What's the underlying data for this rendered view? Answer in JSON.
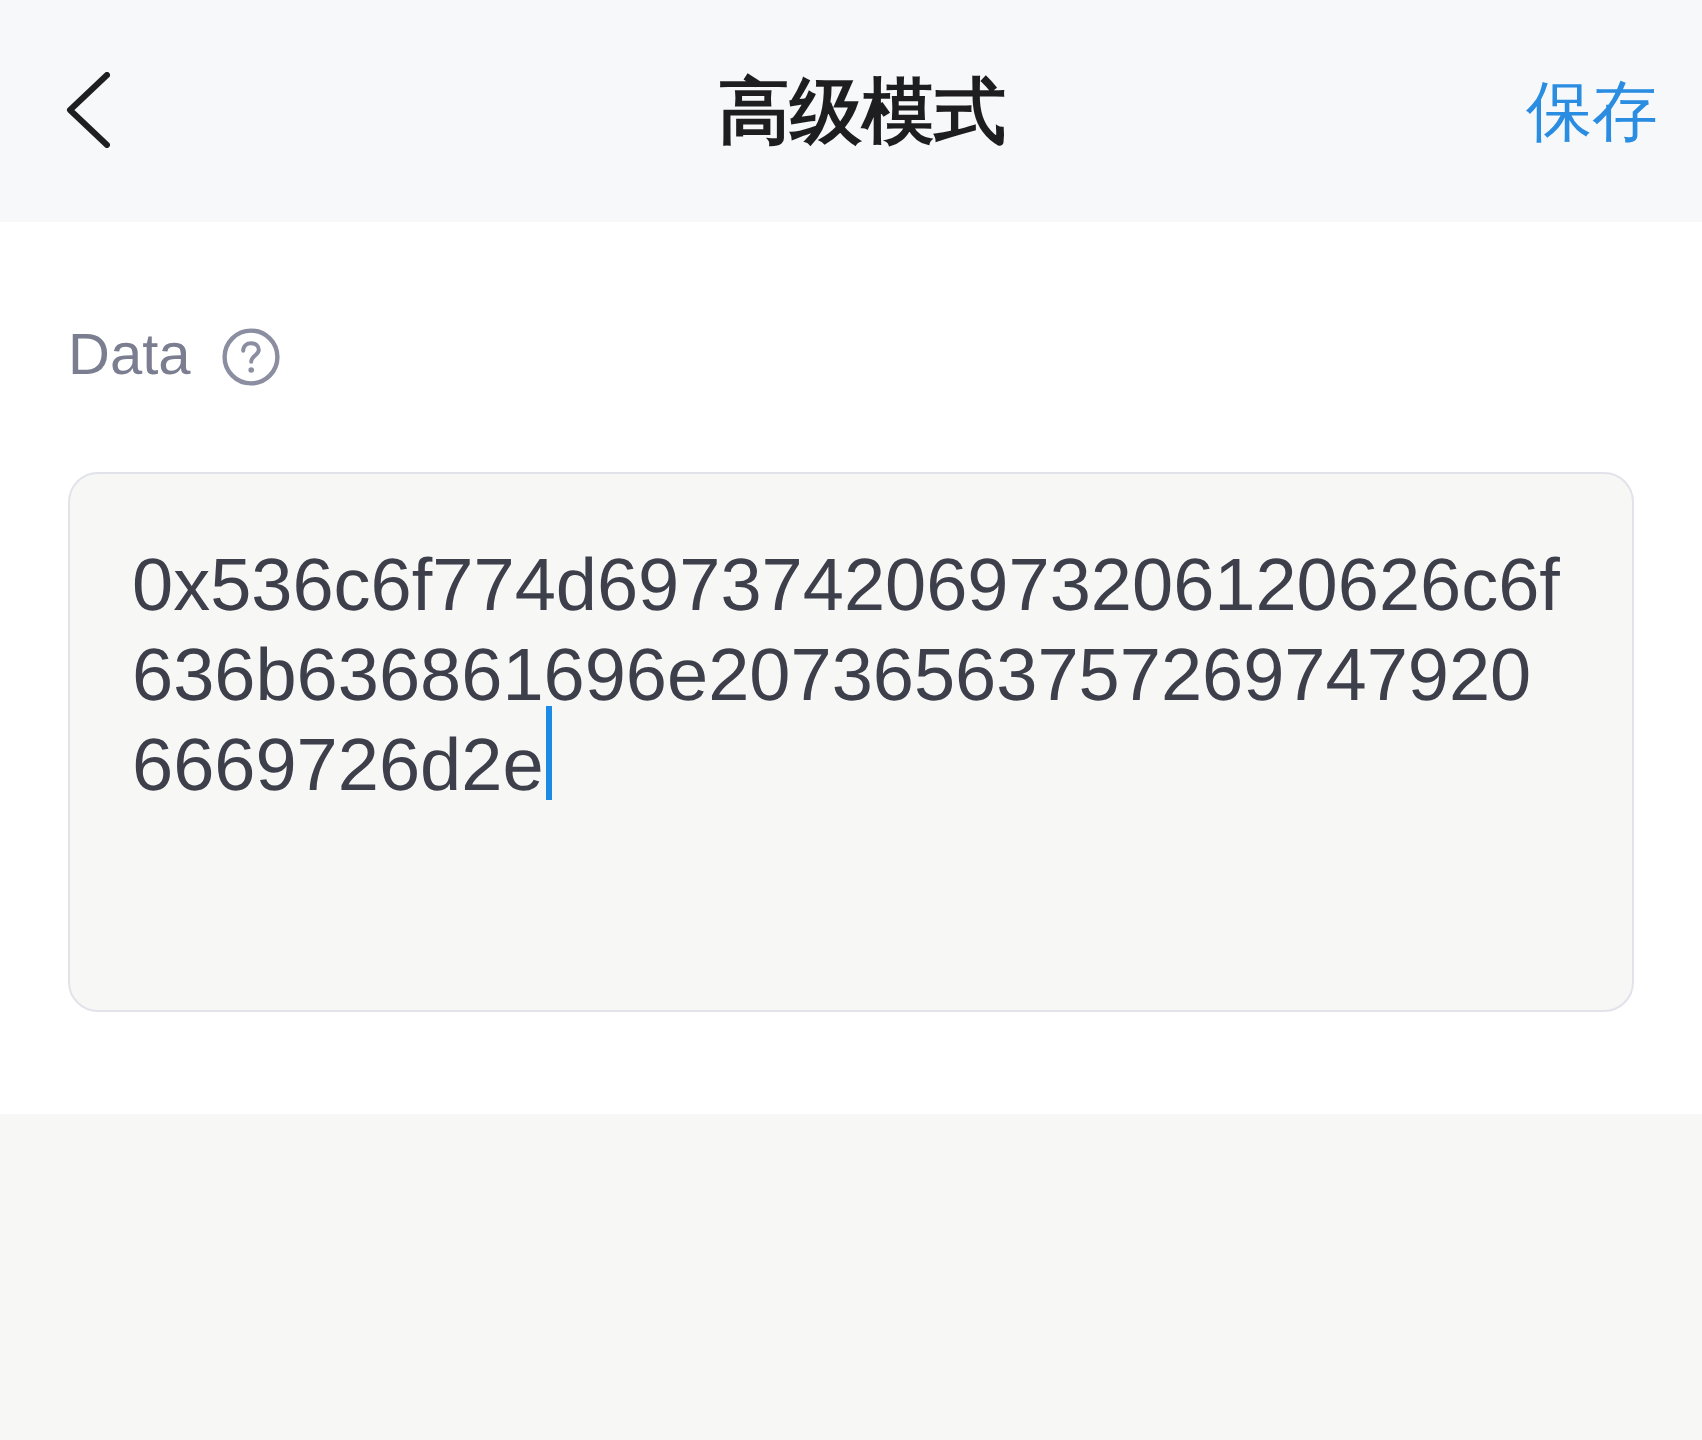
{
  "header": {
    "title": "高级模式",
    "action": "保存"
  },
  "field": {
    "label": "Data",
    "value": "0x536c6f774d697374206973206120626c6f636b636861696e207365637572697479206669726d2e",
    "focused": true
  }
}
